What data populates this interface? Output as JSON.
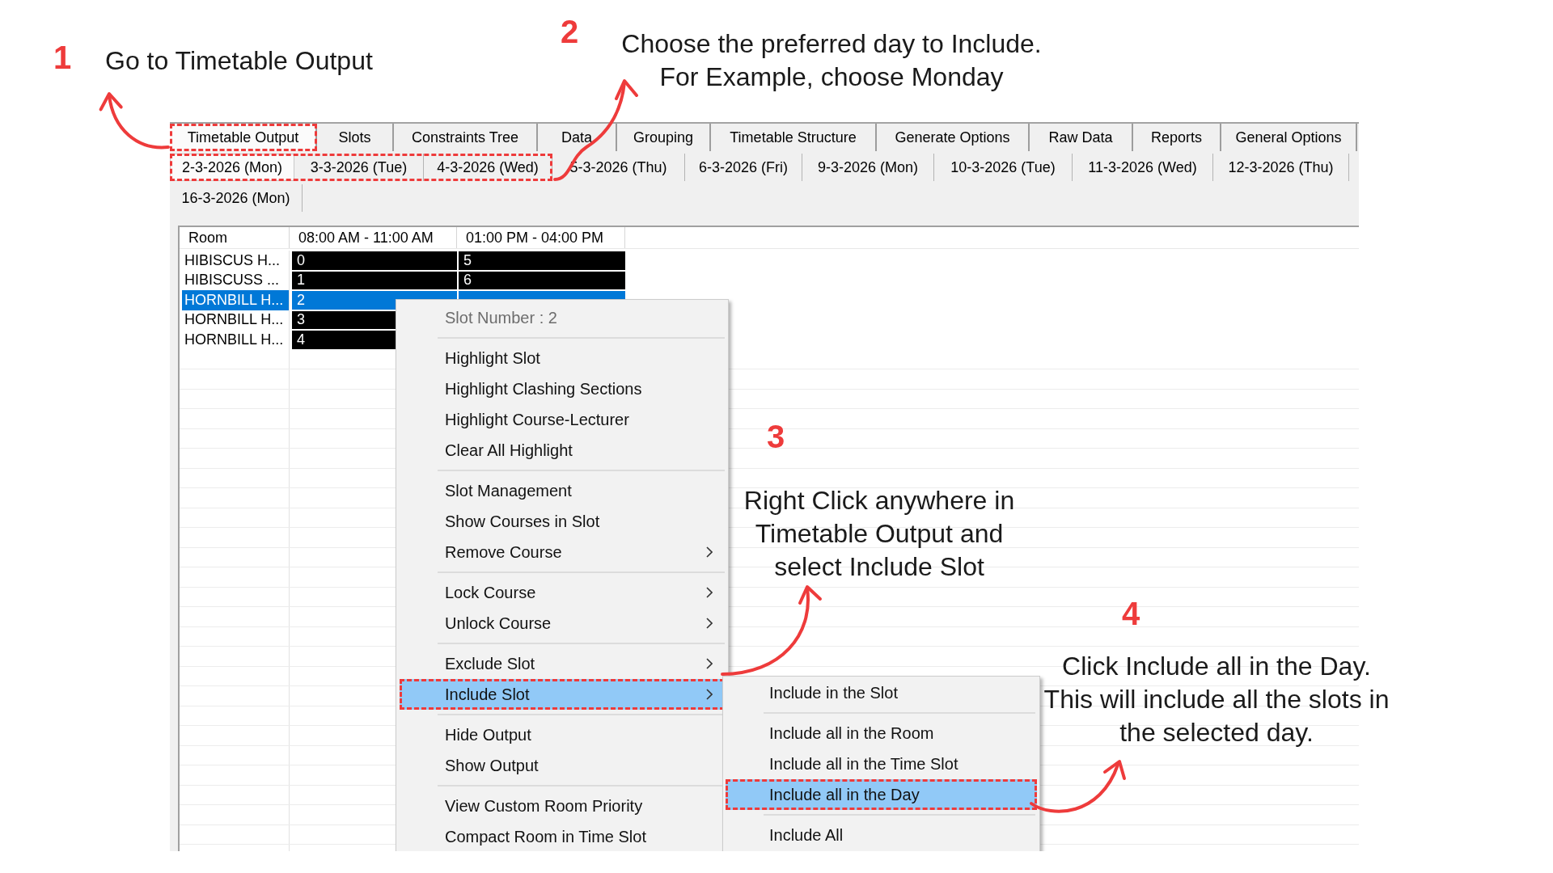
{
  "steps": [
    {
      "number": "1",
      "lines": [
        "Go to Timetable Output"
      ]
    },
    {
      "number": "2",
      "lines": [
        "Choose the preferred day to Include.",
        "For Example, choose Monday"
      ]
    },
    {
      "number": "3",
      "lines": [
        "Right Click anywhere in",
        "Timetable Output and",
        "select Include Slot"
      ]
    },
    {
      "number": "4",
      "lines": [
        "Click Include all in the Day.",
        "This will include all the slots in",
        "the selected day."
      ]
    }
  ],
  "tabs": [
    {
      "label": "Timetable Output",
      "selected": true,
      "marked": true
    },
    {
      "label": "Slots",
      "selected": false,
      "marked": false
    },
    {
      "label": "Constraints Tree",
      "selected": false,
      "marked": false
    },
    {
      "label": "Data",
      "selected": false,
      "marked": false
    },
    {
      "label": "Grouping",
      "selected": false,
      "marked": false
    },
    {
      "label": "Timetable Structure",
      "selected": false,
      "marked": false
    },
    {
      "label": "Generate Options",
      "selected": false,
      "marked": false
    },
    {
      "label": "Raw Data",
      "selected": false,
      "marked": false
    },
    {
      "label": "Reports",
      "selected": false,
      "marked": false
    },
    {
      "label": "General Options",
      "selected": false,
      "marked": false
    }
  ],
  "day_tabs": [
    {
      "label": "2-3-2026 (Mon)",
      "selected": true,
      "marked": true
    },
    {
      "label": "3-3-2026 (Tue)",
      "selected": false,
      "marked": true
    },
    {
      "label": "4-3-2026 (Wed)",
      "selected": false,
      "marked": true
    },
    {
      "label": "5-3-2026 (Thu)",
      "selected": false,
      "marked": false
    },
    {
      "label": "6-3-2026 (Fri)",
      "selected": false,
      "marked": false
    },
    {
      "label": "9-3-2026 (Mon)",
      "selected": false,
      "marked": false
    },
    {
      "label": "10-3-2026 (Tue)",
      "selected": false,
      "marked": false
    },
    {
      "label": "11-3-2026 (Wed)",
      "selected": false,
      "marked": false
    },
    {
      "label": "12-3-2026 (Thu)",
      "selected": false,
      "marked": false
    },
    {
      "label": "16-3-2026 (Mon)",
      "selected": false,
      "marked": false
    }
  ],
  "grid": {
    "columns": [
      "Room",
      "08:00 AM - 11:00 AM",
      "01:00 PM - 04:00 PM"
    ],
    "rows": [
      {
        "selected": false,
        "cells": [
          "HIBISCUS H...",
          "0",
          "5"
        ]
      },
      {
        "selected": false,
        "cells": [
          "HIBISCUSS ...",
          "1",
          "6"
        ]
      },
      {
        "selected": true,
        "cells": [
          "HORNBILL H...",
          "2"
        ]
      },
      {
        "selected": false,
        "cells": [
          "HORNBILL H...",
          "3"
        ]
      },
      {
        "selected": false,
        "cells": [
          "HORNBILL H...",
          "4"
        ]
      }
    ]
  },
  "context_menu": {
    "items": [
      {
        "kind": "header",
        "label": "Slot Number : 2"
      },
      {
        "kind": "separator"
      },
      {
        "kind": "item",
        "label": "Highlight Slot",
        "submenu": false,
        "selected": false,
        "marked": false
      },
      {
        "kind": "item",
        "label": "Highlight Clashing Sections",
        "submenu": false,
        "selected": false,
        "marked": false
      },
      {
        "kind": "item",
        "label": "Highlight Course-Lecturer",
        "submenu": false,
        "selected": false,
        "marked": false
      },
      {
        "kind": "item",
        "label": "Clear All Highlight",
        "submenu": false,
        "selected": false,
        "marked": false
      },
      {
        "kind": "separator"
      },
      {
        "kind": "item",
        "label": "Slot Management",
        "submenu": false,
        "selected": false,
        "marked": false
      },
      {
        "kind": "item",
        "label": "Show Courses in Slot",
        "submenu": false,
        "selected": false,
        "marked": false
      },
      {
        "kind": "item",
        "label": "Remove Course",
        "submenu": true,
        "selected": false,
        "marked": false
      },
      {
        "kind": "separator"
      },
      {
        "kind": "item",
        "label": "Lock Course",
        "submenu": true,
        "selected": false,
        "marked": false
      },
      {
        "kind": "item",
        "label": "Unlock Course",
        "submenu": true,
        "selected": false,
        "marked": false
      },
      {
        "kind": "separator"
      },
      {
        "kind": "item",
        "label": "Exclude Slot",
        "submenu": true,
        "selected": false,
        "marked": false
      },
      {
        "kind": "item",
        "label": "Include Slot",
        "submenu": true,
        "selected": true,
        "marked": true
      },
      {
        "kind": "separator"
      },
      {
        "kind": "item",
        "label": "Hide Output",
        "submenu": false,
        "selected": false,
        "marked": false
      },
      {
        "kind": "item",
        "label": "Show Output",
        "submenu": false,
        "selected": false,
        "marked": false
      },
      {
        "kind": "separator"
      },
      {
        "kind": "item",
        "label": "View Custom Room Priority",
        "submenu": false,
        "selected": false,
        "marked": false
      },
      {
        "kind": "item",
        "label": "Compact Room in Time Slot",
        "submenu": false,
        "selected": false,
        "marked": false
      }
    ]
  },
  "include_submenu": {
    "items": [
      {
        "kind": "item",
        "label": "Include in the Slot",
        "submenu": false,
        "selected": false,
        "marked": false
      },
      {
        "kind": "separator"
      },
      {
        "kind": "item",
        "label": "Include all in the Room",
        "submenu": false,
        "selected": false,
        "marked": false
      },
      {
        "kind": "item",
        "label": "Include all in the Time Slot",
        "submenu": false,
        "selected": false,
        "marked": false
      },
      {
        "kind": "item",
        "label": "Include all in the Day",
        "submenu": false,
        "selected": true,
        "marked": true
      },
      {
        "kind": "separator"
      },
      {
        "kind": "item",
        "label": "Include All",
        "submenu": false,
        "selected": false,
        "marked": false
      }
    ]
  }
}
